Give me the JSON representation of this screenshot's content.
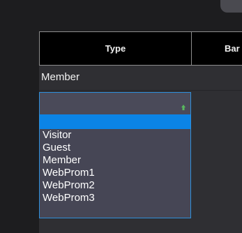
{
  "header": {
    "type_label": "Type",
    "band_label": "Bar"
  },
  "row": {
    "value": "Member"
  },
  "dropdown": {
    "options": [
      "Visitor",
      "Guest",
      "Member",
      "WebProm1",
      "WebProm2",
      "WebProm3"
    ]
  },
  "colors": {
    "background": "#1d1d1f",
    "header_background": "#000000",
    "grid_background": "#2f2f33",
    "dropdown_background": "#464655",
    "selection": "#0b84e6",
    "dropdown_border": "#2f8fdb",
    "arrow": "#59b85f"
  }
}
